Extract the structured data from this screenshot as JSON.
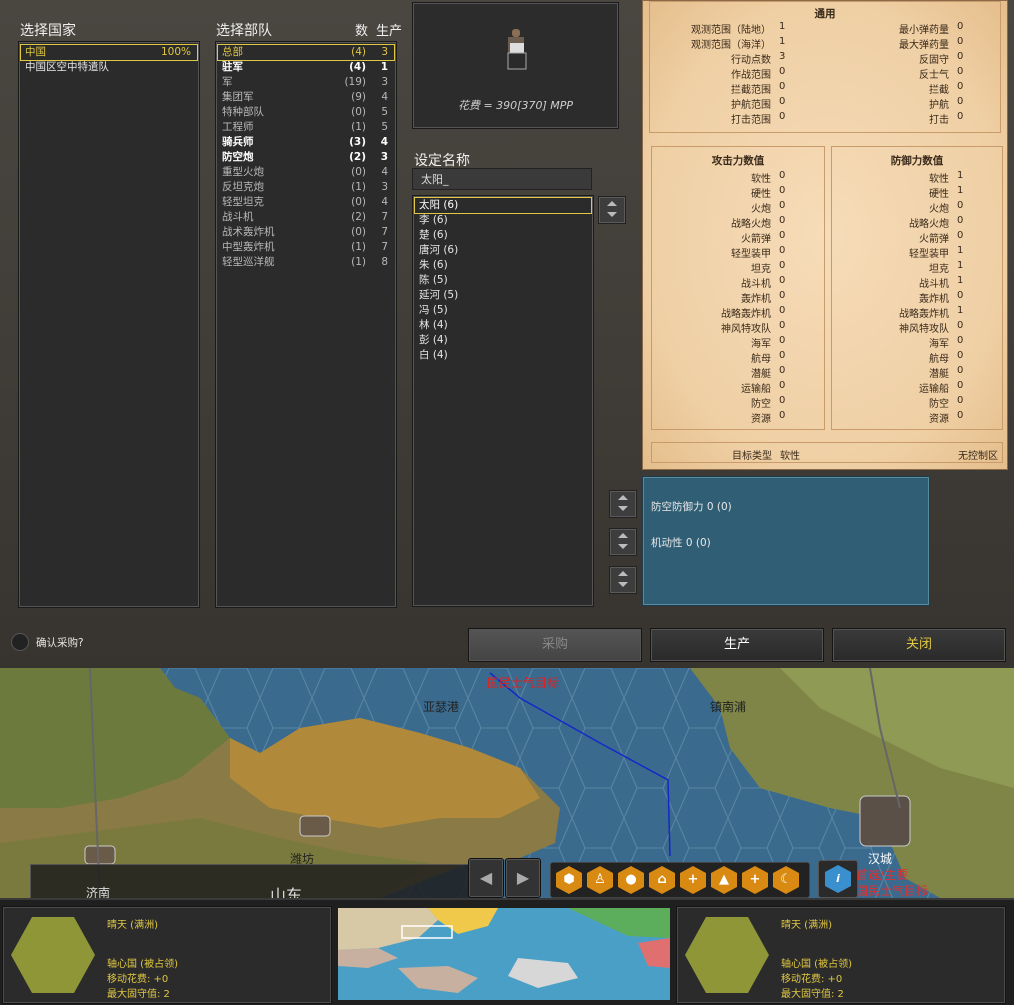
{
  "country": {
    "title": "选择国家",
    "items": [
      {
        "label": "中国",
        "pct": "100%",
        "selected": true
      },
      {
        "label": "中国区空中特遣队",
        "pct": "",
        "selected": false
      }
    ]
  },
  "units": {
    "title": "选择部队",
    "col_num": "数",
    "col_prod": "生产",
    "items": [
      {
        "label": "总部",
        "num": "(4)",
        "prod": "3",
        "style": "sel"
      },
      {
        "label": "驻军",
        "num": "(4)",
        "prod": "1",
        "style": "bold"
      },
      {
        "label": "军",
        "num": "(19)",
        "prod": "3",
        "style": "dim"
      },
      {
        "label": "集团军",
        "num": "(9)",
        "prod": "4",
        "style": "dim"
      },
      {
        "label": "特种部队",
        "num": "(0)",
        "prod": "5",
        "style": "dim"
      },
      {
        "label": "工程师",
        "num": "(1)",
        "prod": "5",
        "style": "dim"
      },
      {
        "label": "骑兵师",
        "num": "(3)",
        "prod": "4",
        "style": "bold"
      },
      {
        "label": "防空炮",
        "num": "(2)",
        "prod": "3",
        "style": "bold"
      },
      {
        "label": "重型火炮",
        "num": "(0)",
        "prod": "4",
        "style": "dim"
      },
      {
        "label": "反坦克炮",
        "num": "(1)",
        "prod": "3",
        "style": "dim"
      },
      {
        "label": "轻型坦克",
        "num": "(0)",
        "prod": "4",
        "style": "dim"
      },
      {
        "label": "战斗机",
        "num": "(2)",
        "prod": "7",
        "style": "dim"
      },
      {
        "label": "战术轰炸机",
        "num": "(0)",
        "prod": "7",
        "style": "dim"
      },
      {
        "label": "中型轰炸机",
        "num": "(1)",
        "prod": "7",
        "style": "dim"
      },
      {
        "label": "轻型巡洋舰",
        "num": "(1)",
        "prod": "8",
        "style": "dim"
      }
    ]
  },
  "cost_text": "花费 = 390[370] MPP",
  "naming": {
    "title": "设定名称",
    "input_value": "太阳_",
    "items": [
      "太阳 (6)",
      "李 (6)",
      "楚 (6)",
      "唐河 (6)",
      "朱 (6)",
      "陈 (5)",
      "延河 (5)",
      "冯 (5)",
      "林 (4)",
      "彭 (4)",
      "白 (4)"
    ]
  },
  "stats": {
    "general_title": "通用",
    "general_left": [
      {
        "k": "观测范围（陆地）",
        "v": "1"
      },
      {
        "k": "观测范围（海洋）",
        "v": "1"
      },
      {
        "k": "行动点数",
        "v": "3"
      },
      {
        "k": "作战范围",
        "v": "0"
      },
      {
        "k": "拦截范围",
        "v": "0"
      },
      {
        "k": "护航范围",
        "v": "0"
      },
      {
        "k": "打击范围",
        "v": "0"
      }
    ],
    "general_right": [
      {
        "k": "最小弹药量",
        "v": "0"
      },
      {
        "k": "最大弹药量",
        "v": "0"
      },
      {
        "k": "反固守",
        "v": "0"
      },
      {
        "k": "反士气",
        "v": "0"
      },
      {
        "k": "拦截",
        "v": "0"
      },
      {
        "k": "护航",
        "v": "0"
      },
      {
        "k": "打击",
        "v": "0"
      }
    ],
    "attack_title": "攻击力数值",
    "defense_title": "防御力数值",
    "attack": [
      {
        "k": "软性",
        "v": "0"
      },
      {
        "k": "硬性",
        "v": "0"
      },
      {
        "k": "火炮",
        "v": "0"
      },
      {
        "k": "战略火炮",
        "v": "0"
      },
      {
        "k": "火箭弹",
        "v": "0"
      },
      {
        "k": "轻型装甲",
        "v": "0"
      },
      {
        "k": "坦克",
        "v": "0"
      },
      {
        "k": "战斗机",
        "v": "0"
      },
      {
        "k": "轰炸机",
        "v": "0"
      },
      {
        "k": "战略轰炸机",
        "v": "0"
      },
      {
        "k": "神风特攻队",
        "v": "0"
      },
      {
        "k": "海军",
        "v": "0"
      },
      {
        "k": "航母",
        "v": "0"
      },
      {
        "k": "潜艇",
        "v": "0"
      },
      {
        "k": "运输船",
        "v": "0"
      },
      {
        "k": "防空",
        "v": "0"
      },
      {
        "k": "资源",
        "v": "0"
      }
    ],
    "defense": [
      {
        "k": "软性",
        "v": "1"
      },
      {
        "k": "硬性",
        "v": "1"
      },
      {
        "k": "火炮",
        "v": "0"
      },
      {
        "k": "战略火炮",
        "v": "0"
      },
      {
        "k": "火箭弹",
        "v": "0"
      },
      {
        "k": "轻型装甲",
        "v": "1"
      },
      {
        "k": "坦克",
        "v": "1"
      },
      {
        "k": "战斗机",
        "v": "1"
      },
      {
        "k": "轰炸机",
        "v": "0"
      },
      {
        "k": "战略轰炸机",
        "v": "1"
      },
      {
        "k": "神风特攻队",
        "v": "0"
      },
      {
        "k": "海军",
        "v": "0"
      },
      {
        "k": "航母",
        "v": "0"
      },
      {
        "k": "潜艇",
        "v": "0"
      },
      {
        "k": "运输船",
        "v": "0"
      },
      {
        "k": "防空",
        "v": "0"
      },
      {
        "k": "资源",
        "v": "0"
      }
    ],
    "target_label": "目标类型",
    "target_value": "软性",
    "zoc": "无控制区"
  },
  "upgrades": {
    "aa": "防空防御力 0  (0)",
    "mobility": "机动性 0  (0)"
  },
  "confirm_label": "确认采购?",
  "buttons": {
    "buy": "采购",
    "produce": "生产",
    "close": "关闭"
  },
  "map": {
    "labels": [
      "亚瑟港",
      "镇南浦",
      "潍坊",
      "汉城"
    ],
    "objective": "国民士气目标",
    "objective2": "首选/主要",
    "objective3": "国民士气目标",
    "partial_left": "济南",
    "partial_mid": "山东"
  },
  "tiles": [
    {
      "weather": "晴天 (满洲)",
      "owner": "轴心国 (被占领)",
      "move": "移动花费: +0",
      "entrench": "最大固守值: 2"
    },
    {
      "weather": "晴天 (满洲)",
      "owner": "轴心国 (被占领)",
      "move": "移动花费: +0",
      "entrench": "最大固守值: 2"
    }
  ],
  "colors": {
    "accent": "#e0c842",
    "orange": "#d98a12",
    "sea": "#2f5e75"
  }
}
